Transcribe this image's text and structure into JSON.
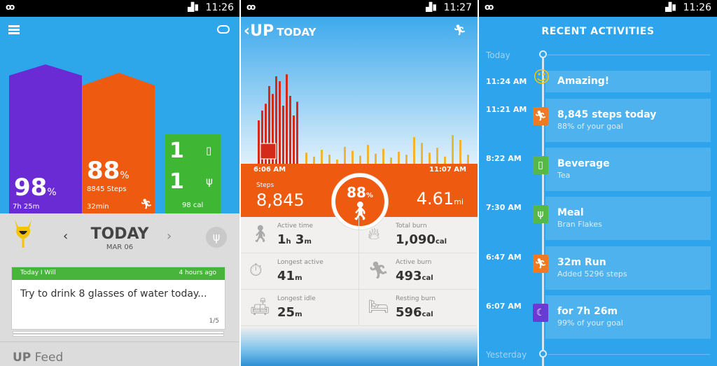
{
  "status_bar": {
    "time_1": "11:26",
    "time_2": "11:27",
    "time_3": "11:26"
  },
  "screen1": {
    "sleep_pct": "98",
    "sleep_pct_unit": "%",
    "sleep_duration": "7h 25m",
    "steps_pct": "88",
    "steps_pct_unit": "%",
    "steps_sub": "8845 Steps",
    "steps_time": "32min",
    "drinks_count": "1",
    "meals_count": "1",
    "calories": "98 cal",
    "today_title": "TODAY",
    "today_date": "MAR 06",
    "card_header_left": "Today I Will",
    "card_header_right": "4 hours ago",
    "card_text": "Try to drink 8 glasses of water today...",
    "card_page": "1/5",
    "feed_bold": "UP",
    "feed_rest": "Feed"
  },
  "screen2": {
    "brand": "UP",
    "title": "TODAY",
    "start_time": "6:06 AM",
    "end_time": "11:07 AM",
    "steps_label": "Steps",
    "steps_value": "8,845",
    "goal_pct": "88",
    "goal_pct_unit": "%",
    "distance_value": "4.61",
    "distance_unit": "mi",
    "stats": [
      {
        "label": "Active time",
        "value": "1",
        "unit": "h",
        "value2": " 3",
        "unit2": "m",
        "icon": "walking-icon"
      },
      {
        "label": "Total burn",
        "value": "1,090",
        "unit": "cal",
        "icon": "flame-person-icon"
      },
      {
        "label": "Longest active",
        "value": "41",
        "unit": "m",
        "icon": "stopwatch-runner-icon"
      },
      {
        "label": "Active burn",
        "value": "493",
        "unit": "cal",
        "icon": "burn-runner-icon"
      },
      {
        "label": "Longest idle",
        "value": "25",
        "unit": "m",
        "icon": "sofa-icon"
      },
      {
        "label": "Resting burn",
        "value": "596",
        "unit": "cal",
        "icon": "resting-burn-icon"
      }
    ],
    "activity_bars": {
      "red": [
        0.45,
        0.55,
        0.62,
        0.8,
        0.72,
        0.9,
        0.85,
        0.6,
        0.92,
        0.7,
        0.5,
        0.64
      ],
      "yellow_positions_fraction": "not-layout",
      "yellow": [
        0.12,
        0.08,
        0.15,
        0.1,
        0.05,
        0.18,
        0.14,
        0.09,
        0.2,
        0.11,
        0.16,
        0.07,
        0.13,
        0.1,
        0.28,
        0.22,
        0.12,
        0.17,
        0.08,
        0.3,
        0.25,
        0.1
      ]
    },
    "colors": {
      "orange": "#ee5a10",
      "red": "#d42a1a",
      "yellow": "#f0b433"
    }
  },
  "screen3": {
    "title": "RECENT ACTIVITIES",
    "today_label": "Today",
    "yesterday_label": "Yesterday",
    "items": [
      {
        "time": "11:24 AM",
        "title": "Amazing!",
        "sub": "",
        "icon": "smiley-sun-icon",
        "color": "#f5c400"
      },
      {
        "time": "11:21 AM",
        "title": "8,845 steps today",
        "sub": "88% of your goal",
        "icon": "runner-icon",
        "color": "#f07a22"
      },
      {
        "time": "8:22 AM",
        "title": "Beverage",
        "sub": "Tea",
        "icon": "glass-icon",
        "color": "#56b947"
      },
      {
        "time": "7:30 AM",
        "title": "Meal",
        "sub": "Bran Flakes",
        "icon": "fork-knife-icon",
        "color": "#56b947"
      },
      {
        "time": "6:47 AM",
        "title": "32m Run",
        "sub": "Added 5296 steps",
        "icon": "runner-icon",
        "color": "#f07a22"
      },
      {
        "time": "6:07 AM",
        "title": "for 7h 26m",
        "sub": "99% of your goal",
        "icon": "moon-icon",
        "color": "#6a3bd4"
      }
    ]
  }
}
